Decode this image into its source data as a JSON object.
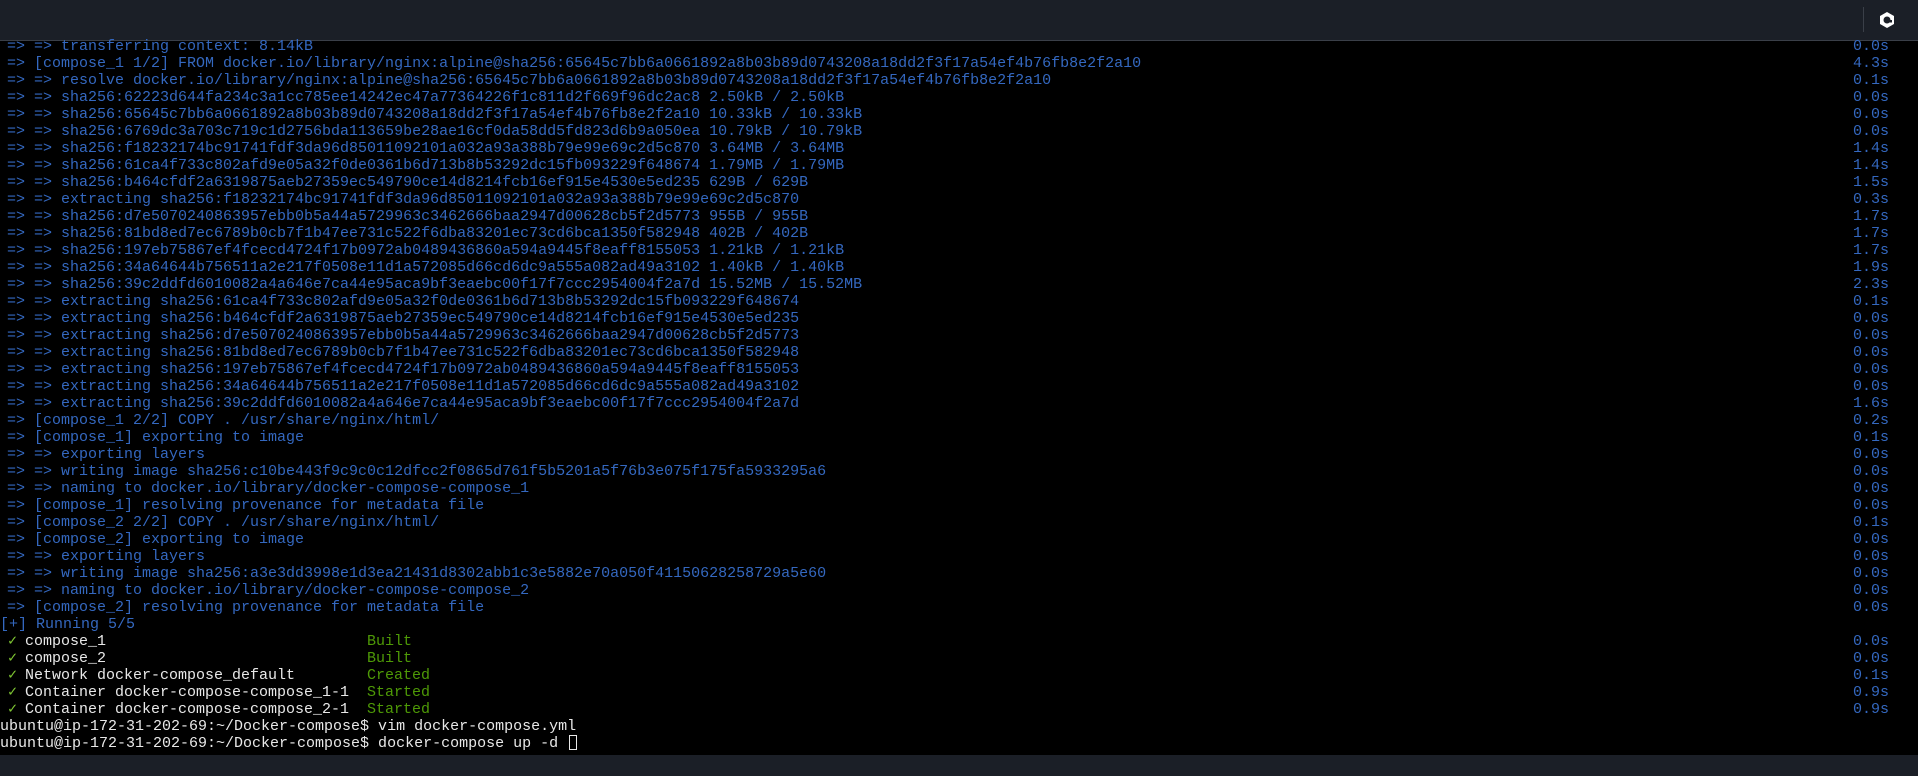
{
  "colors": {
    "log_blue": "#3468c0",
    "success_green": "#4e9a06",
    "check_green": "#7ec432",
    "text_white": "#e8e8e8",
    "bar_bg": "#1b1f27"
  },
  "topbar": {
    "icon": "hexagon-logo-icon"
  },
  "build_lines": [
    {
      "text": "=> => transferring context: 8.14kB",
      "time": "0.0s"
    },
    {
      "text": "=> [compose_1 1/2] FROM docker.io/library/nginx:alpine@sha256:65645c7bb6a0661892a8b03b89d0743208a18dd2f3f17a54ef4b76fb8e2f2a10",
      "time": "4.3s"
    },
    {
      "text": "=> => resolve docker.io/library/nginx:alpine@sha256:65645c7bb6a0661892a8b03b89d0743208a18dd2f3f17a54ef4b76fb8e2f2a10",
      "time": "0.1s"
    },
    {
      "text": "=> => sha256:62223d644fa234c3a1cc785ee14242ec47a77364226f1c811d2f669f96dc2ac8 2.50kB / 2.50kB",
      "time": "0.0s"
    },
    {
      "text": "=> => sha256:65645c7bb6a0661892a8b03b89d0743208a18dd2f3f17a54ef4b76fb8e2f2a10 10.33kB / 10.33kB",
      "time": "0.0s"
    },
    {
      "text": "=> => sha256:6769dc3a703c719c1d2756bda113659be28ae16cf0da58dd5fd823d6b9a050ea 10.79kB / 10.79kB",
      "time": "0.0s"
    },
    {
      "text": "=> => sha256:f18232174bc91741fdf3da96d85011092101a032a93a388b79e99e69c2d5c870 3.64MB / 3.64MB",
      "time": "1.4s"
    },
    {
      "text": "=> => sha256:61ca4f733c802afd9e05a32f0de0361b6d713b8b53292dc15fb093229f648674 1.79MB / 1.79MB",
      "time": "1.4s"
    },
    {
      "text": "=> => sha256:b464cfdf2a6319875aeb27359ec549790ce14d8214fcb16ef915e4530e5ed235 629B / 629B",
      "time": "1.5s"
    },
    {
      "text": "=> => extracting sha256:f18232174bc91741fdf3da96d85011092101a032a93a388b79e99e69c2d5c870",
      "time": "0.3s"
    },
    {
      "text": "=> => sha256:d7e5070240863957ebb0b5a44a5729963c3462666baa2947d00628cb5f2d5773 955B / 955B",
      "time": "1.7s"
    },
    {
      "text": "=> => sha256:81bd8ed7ec6789b0cb7f1b47ee731c522f6dba83201ec73cd6bca1350f582948 402B / 402B",
      "time": "1.7s"
    },
    {
      "text": "=> => sha256:197eb75867ef4fcecd4724f17b0972ab0489436860a594a9445f8eaff8155053 1.21kB / 1.21kB",
      "time": "1.7s"
    },
    {
      "text": "=> => sha256:34a64644b756511a2e217f0508e11d1a572085d66cd6dc9a555a082ad49a3102 1.40kB / 1.40kB",
      "time": "1.9s"
    },
    {
      "text": "=> => sha256:39c2ddfd6010082a4a646e7ca44e95aca9bf3eaebc00f17f7ccc2954004f2a7d 15.52MB / 15.52MB",
      "time": "2.3s"
    },
    {
      "text": "=> => extracting sha256:61ca4f733c802afd9e05a32f0de0361b6d713b8b53292dc15fb093229f648674",
      "time": "0.1s"
    },
    {
      "text": "=> => extracting sha256:b464cfdf2a6319875aeb27359ec549790ce14d8214fcb16ef915e4530e5ed235",
      "time": "0.0s"
    },
    {
      "text": "=> => extracting sha256:d7e5070240863957ebb0b5a44a5729963c3462666baa2947d00628cb5f2d5773",
      "time": "0.0s"
    },
    {
      "text": "=> => extracting sha256:81bd8ed7ec6789b0cb7f1b47ee731c522f6dba83201ec73cd6bca1350f582948",
      "time": "0.0s"
    },
    {
      "text": "=> => extracting sha256:197eb75867ef4fcecd4724f17b0972ab0489436860a594a9445f8eaff8155053",
      "time": "0.0s"
    },
    {
      "text": "=> => extracting sha256:34a64644b756511a2e217f0508e11d1a572085d66cd6dc9a555a082ad49a3102",
      "time": "0.0s"
    },
    {
      "text": "=> => extracting sha256:39c2ddfd6010082a4a646e7ca44e95aca9bf3eaebc00f17f7ccc2954004f2a7d",
      "time": "1.6s"
    },
    {
      "text": "=> [compose_1 2/2] COPY . /usr/share/nginx/html/",
      "time": "0.2s"
    },
    {
      "text": "=> [compose_1] exporting to image",
      "time": "0.1s"
    },
    {
      "text": "=> => exporting layers",
      "time": "0.0s"
    },
    {
      "text": "=> => writing image sha256:c10be443f9c9c0c12dfcc2f0865d761f5b5201a5f76b3e075f175fa5933295a6",
      "time": "0.0s"
    },
    {
      "text": "=> => naming to docker.io/library/docker-compose-compose_1",
      "time": "0.0s"
    },
    {
      "text": "=> [compose_1] resolving provenance for metadata file",
      "time": "0.0s"
    },
    {
      "text": "=> [compose_2 2/2] COPY . /usr/share/nginx/html/",
      "time": "0.1s"
    },
    {
      "text": "=> [compose_2] exporting to image",
      "time": "0.0s"
    },
    {
      "text": "=> => exporting layers",
      "time": "0.0s"
    },
    {
      "text": "=> => writing image sha256:a3e3dd3998e1d3ea21431d8302abb1c3e5882e70a050f41150628258729a5e60",
      "time": "0.0s"
    },
    {
      "text": "=> => naming to docker.io/library/docker-compose-compose_2",
      "time": "0.0s"
    },
    {
      "text": "=> [compose_2] resolving provenance for metadata file",
      "time": "0.0s"
    }
  ],
  "running": {
    "text": "[+] Running 5/5"
  },
  "results": [
    {
      "check": "✓",
      "name": "compose_1",
      "status": "Built",
      "time": "0.0s"
    },
    {
      "check": "✓",
      "name": "compose_2",
      "status": "Built",
      "time": "0.0s"
    },
    {
      "check": "✓",
      "name": "Network docker-compose_default",
      "status": "Created",
      "time": "0.1s"
    },
    {
      "check": "✓",
      "name": "Container docker-compose-compose_1-1",
      "status": "Started",
      "time": "0.9s"
    },
    {
      "check": "✓",
      "name": "Container docker-compose-compose_2-1",
      "status": "Started",
      "time": "0.9s"
    }
  ],
  "prompts": [
    {
      "text": "ubuntu@ip-172-31-202-69:~/Docker-compose$ vim docker-compose.yml"
    },
    {
      "text": "ubuntu@ip-172-31-202-69:~/Docker-compose$ docker-compose up -d "
    }
  ]
}
